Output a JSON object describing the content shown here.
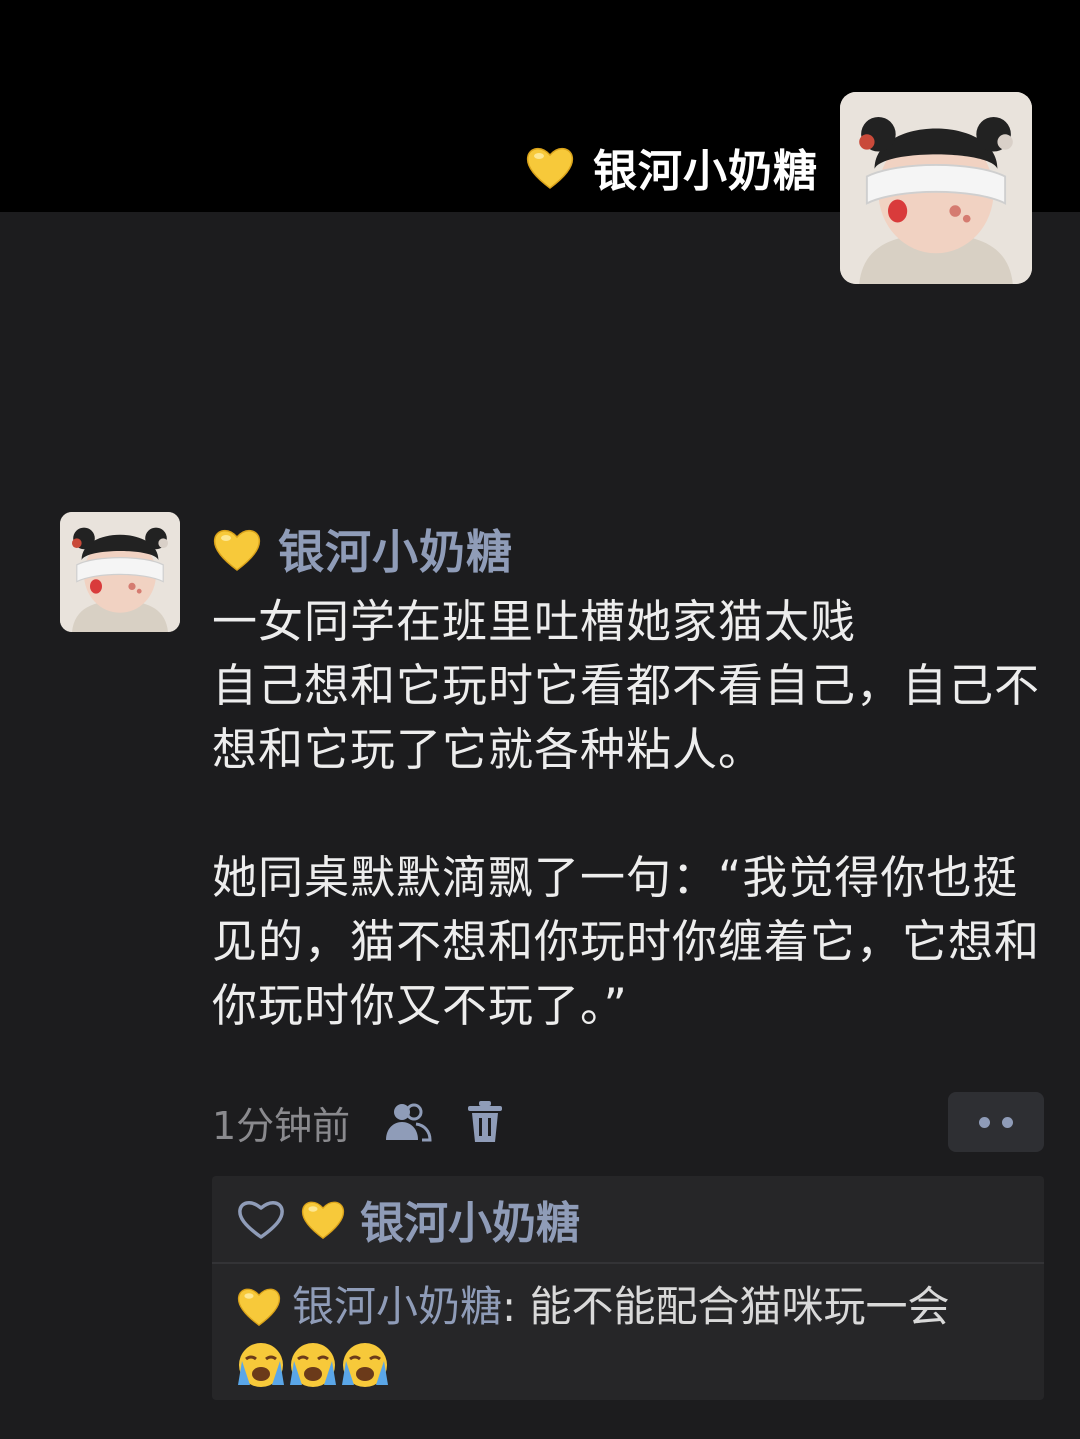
{
  "cover": {
    "username": "银河小奶糖",
    "badge_icon": "yellow-heart-icon"
  },
  "post": {
    "username": "银河小奶糖",
    "badge_icon": "yellow-heart-icon",
    "text": "一女同学在班里吐槽她家猫太贱\n自己想和它玩时它看都不看自己，自己不想和它玩了它就各种粘人。\n\n她同桌默默滴飘了一句：“我觉得你也挺见的，猫不想和你玩时你缠着它，它想和你玩时你又不玩了。”",
    "timestamp": "1分钟前",
    "icons": [
      "friends-visibility-icon",
      "trash-icon",
      "more-icon"
    ]
  },
  "likes": {
    "icon": "heart-outline-icon",
    "users": [
      "银河小奶糖"
    ]
  },
  "comment": {
    "username": "银河小奶糖",
    "separator": ":",
    "text": " 能不能配合猫咪玩一会",
    "emoji_icon": "loudly-crying-face-icon",
    "emoji_count": 3
  },
  "colors": {
    "background": "#1c1c1e",
    "cover": "#000000",
    "name_link": "#8f9cb8",
    "text": "#ededed",
    "muted": "#8a8a8e"
  }
}
